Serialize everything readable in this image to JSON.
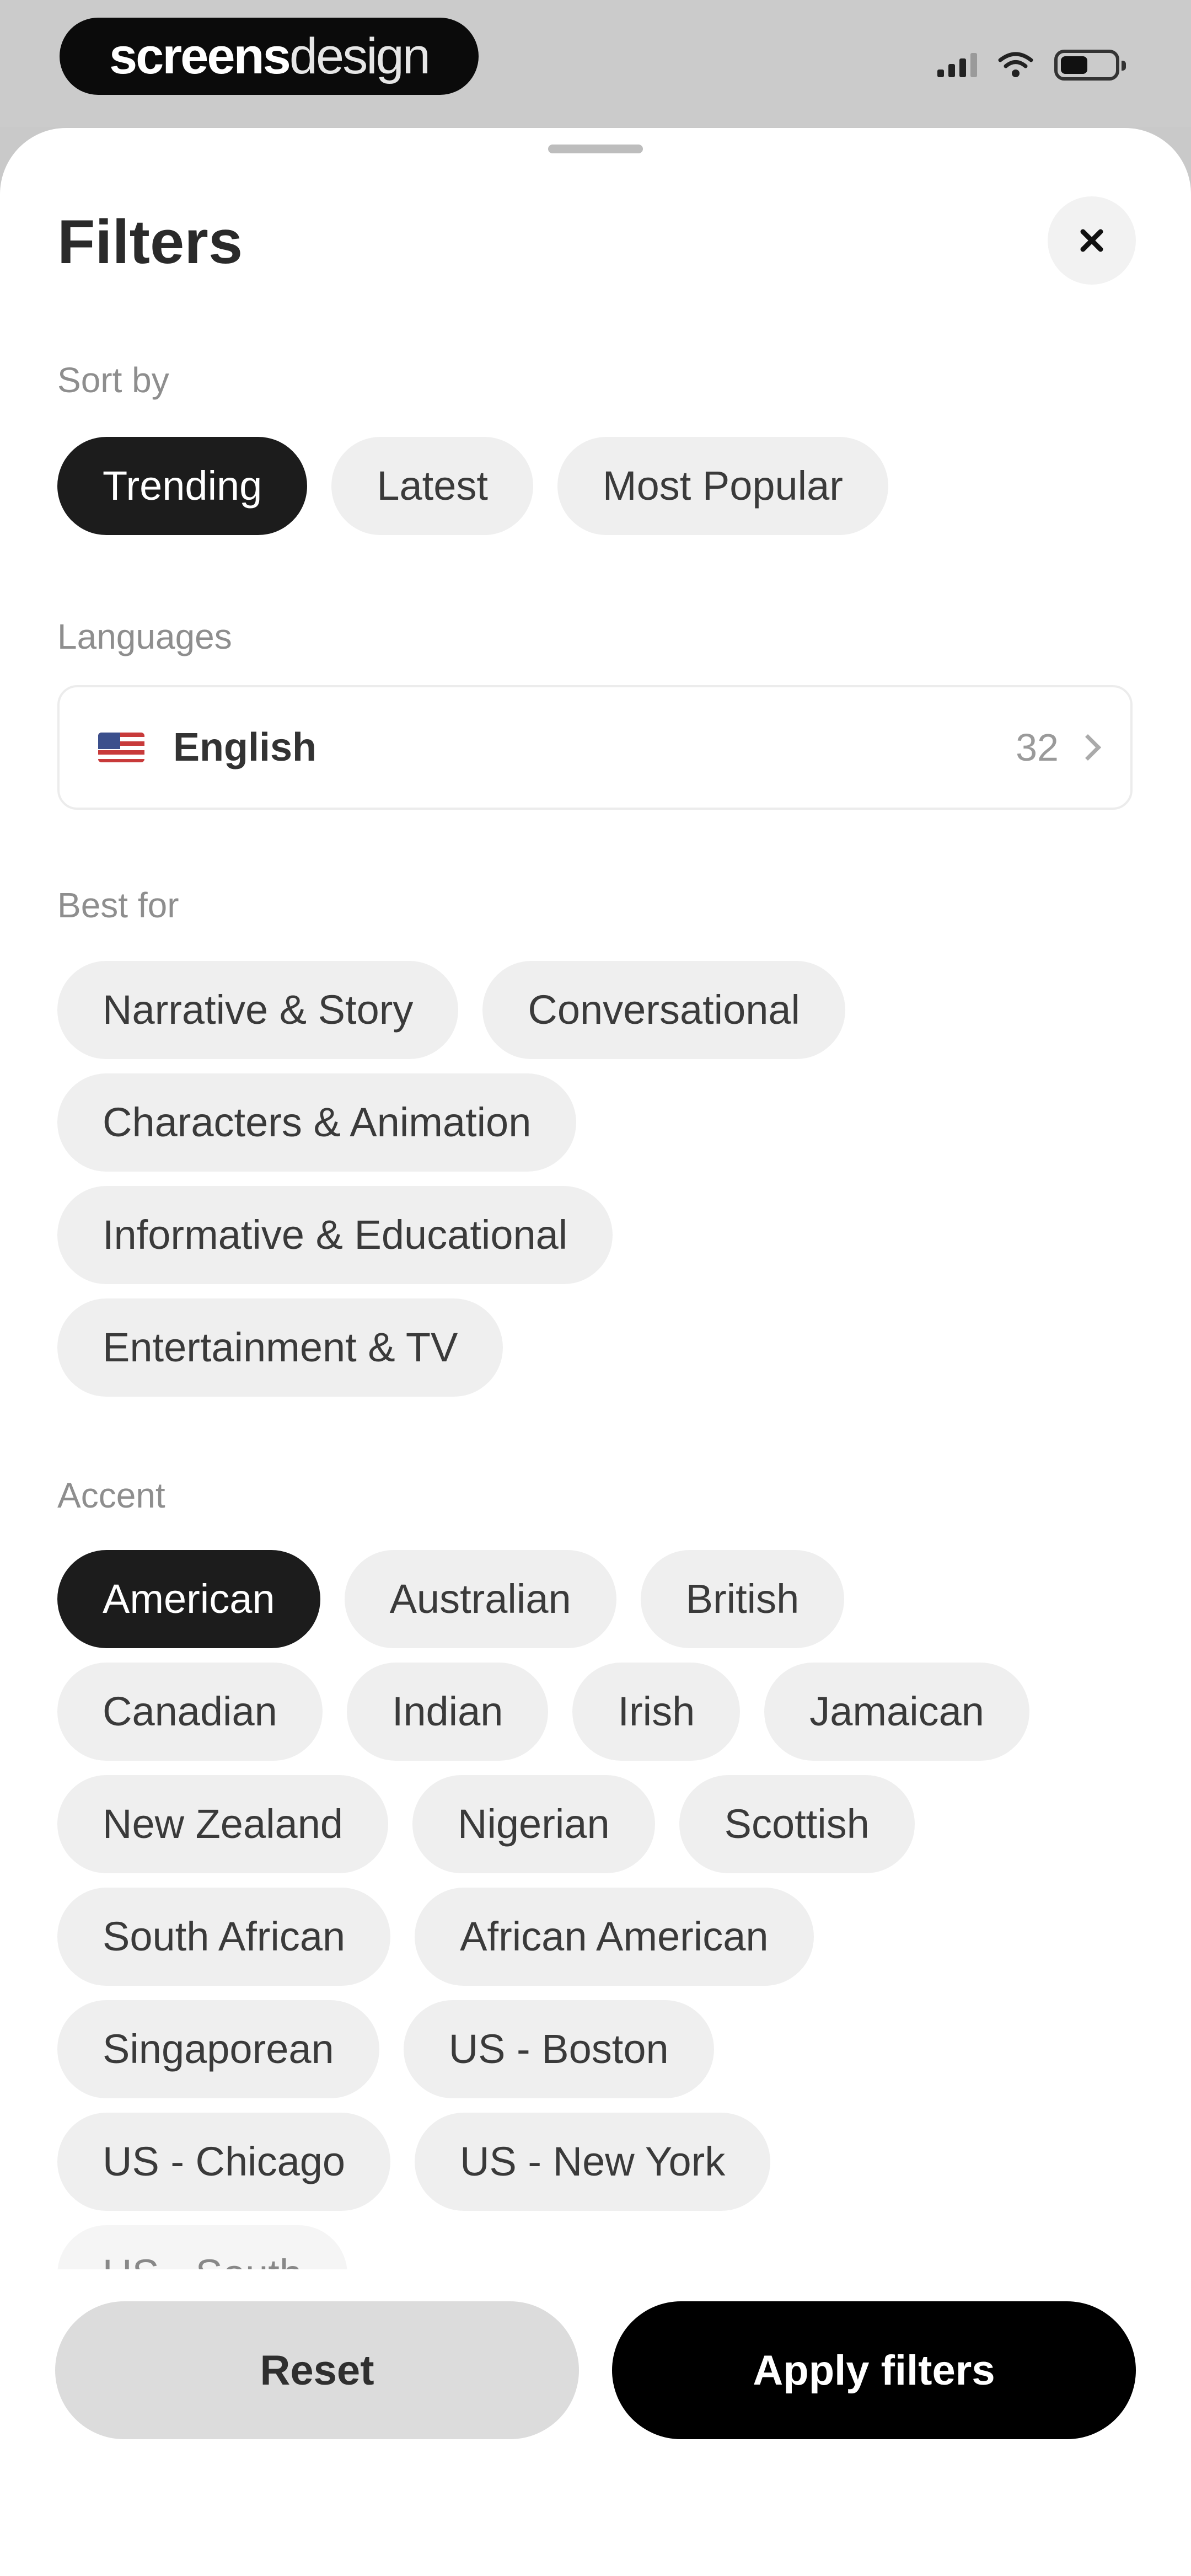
{
  "status_bar": {
    "brand_bold": "screens",
    "brand_light": "design"
  },
  "sheet": {
    "title": "Filters",
    "close_icon": "close-icon"
  },
  "sort_by": {
    "label": "Sort by",
    "options": [
      "Trending",
      "Latest",
      "Most Popular"
    ],
    "selected": "Trending"
  },
  "languages": {
    "label": "Languages",
    "selected": "English",
    "count": "32",
    "flag_icon": "us-flag-icon"
  },
  "best_for": {
    "label": "Best for",
    "rows": [
      [
        "Narrative & Story",
        "Conversational"
      ],
      [
        "Characters & Animation"
      ],
      [
        "Informative & Educational"
      ],
      [
        "Entertainment & TV"
      ]
    ]
  },
  "accent": {
    "label": "Accent",
    "selected": "American",
    "rows": [
      [
        "American",
        "Australian",
        "British"
      ],
      [
        "Canadian",
        "Indian",
        "Irish",
        "Jamaican"
      ],
      [
        "New Zealand",
        "Nigerian",
        "Scottish"
      ],
      [
        "South African",
        "African American"
      ],
      [
        "Singaporean",
        "US - Boston"
      ],
      [
        "US - Chicago",
        "US - New York"
      ]
    ],
    "partial_next": "US - South"
  },
  "footer": {
    "reset_label": "Reset",
    "apply_label": "Apply filters"
  },
  "colors": {
    "active_chip": "#1c1c1c",
    "inactive_chip": "#efefef",
    "apply_button": "#000000",
    "reset_button": "#dcdcdc"
  }
}
